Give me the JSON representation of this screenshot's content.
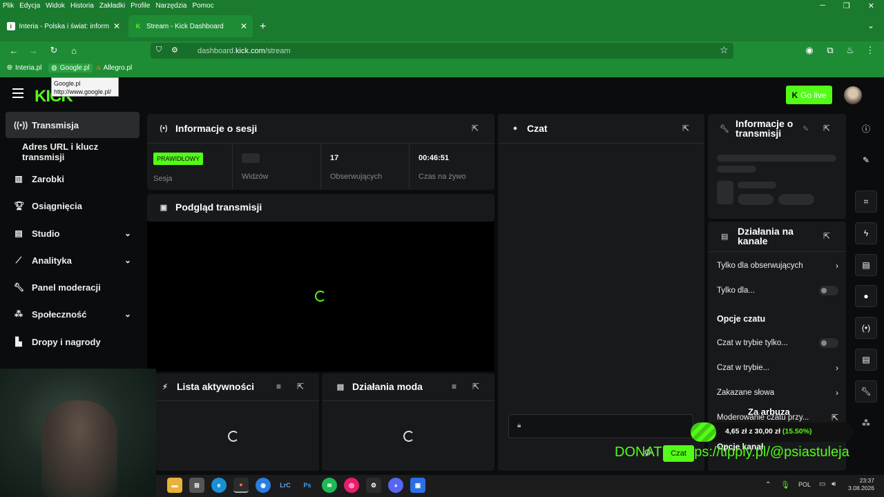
{
  "browser": {
    "menu": [
      "Plik",
      "Edycja",
      "Widok",
      "Historia",
      "Zakładki",
      "Profile",
      "Narzędzia",
      "Pomoc"
    ],
    "tabs": [
      {
        "title": "Interia - Polska i świat: informacje"
      },
      {
        "title": "Stream - Kick Dashboard"
      }
    ],
    "url_prefix": "dashboard.",
    "url_domain": "kick.com",
    "url_path": "/stream",
    "bookmarks": [
      "Interia.pl",
      "Google.pl",
      "Allegro.pl"
    ],
    "tooltip": {
      "title": "Google.pl",
      "url": "http://www.google.pl/"
    }
  },
  "header": {
    "logo": "KICK",
    "go_live": "Go live"
  },
  "sidebar": {
    "items": [
      {
        "label": "Transmisja",
        "icon": "broadcast-icon"
      },
      {
        "label": "Adres URL i klucz transmisji"
      },
      {
        "label": "Zarobki",
        "icon": "chart-icon"
      },
      {
        "label": "Osiągnięcia",
        "icon": "trophy-icon"
      },
      {
        "label": "Studio",
        "icon": "studio-icon"
      },
      {
        "label": "Analityka",
        "icon": "analytics-icon"
      },
      {
        "label": "Panel moderacji",
        "icon": "wrench-icon"
      },
      {
        "label": "Społeczność",
        "icon": "community-icon"
      },
      {
        "label": "Dropy i nagrody",
        "icon": "gift-icon"
      }
    ]
  },
  "session": {
    "title": "Informacje o sesji",
    "badge": "PRAWIDŁOWY",
    "label_session": "Sesja",
    "label_viewers": "Widzów",
    "followers_value": "17",
    "label_followers": "Obserwujących",
    "live_time": "00:46:51",
    "label_live": "Czas na żywo"
  },
  "preview": {
    "title": "Podgląd transmisji"
  },
  "activity": {
    "title": "Lista aktywności"
  },
  "mod_actions": {
    "title": "Działania moda"
  },
  "chat": {
    "title": "Czat",
    "send_label": "Czat"
  },
  "stream_info": {
    "title_line1": "Informacje o",
    "title_line2": "transmisji"
  },
  "channel_actions": {
    "title_line1": "Działania na",
    "title_line2": "kanale",
    "rows": [
      "Tylko dla obserwujących",
      "Tylko dla...",
      "Opcje czatu",
      "Czat w trybie tylko...",
      "Czat w trybie...",
      "Zakazane słowa",
      "Moderowanie czatu przy...",
      "Opcje kanał"
    ]
  },
  "overlay": {
    "goal_title": "Za arbuza",
    "goal_amount": "4,65 zł",
    "goal_sep": "z",
    "goal_target": "30,00 zł",
    "goal_percent": "(15.50%)",
    "goal_progress_pct": 15.5,
    "donate": "DONATE: https://tipply.pl/@psiastuleja"
  },
  "taskbar": {
    "lang": "POL",
    "time": "23:37",
    "date": "3.08.2026"
  },
  "colors": {
    "accent": "#53fc18",
    "browser_green": "#1e8c35",
    "panel": "#18191b"
  }
}
